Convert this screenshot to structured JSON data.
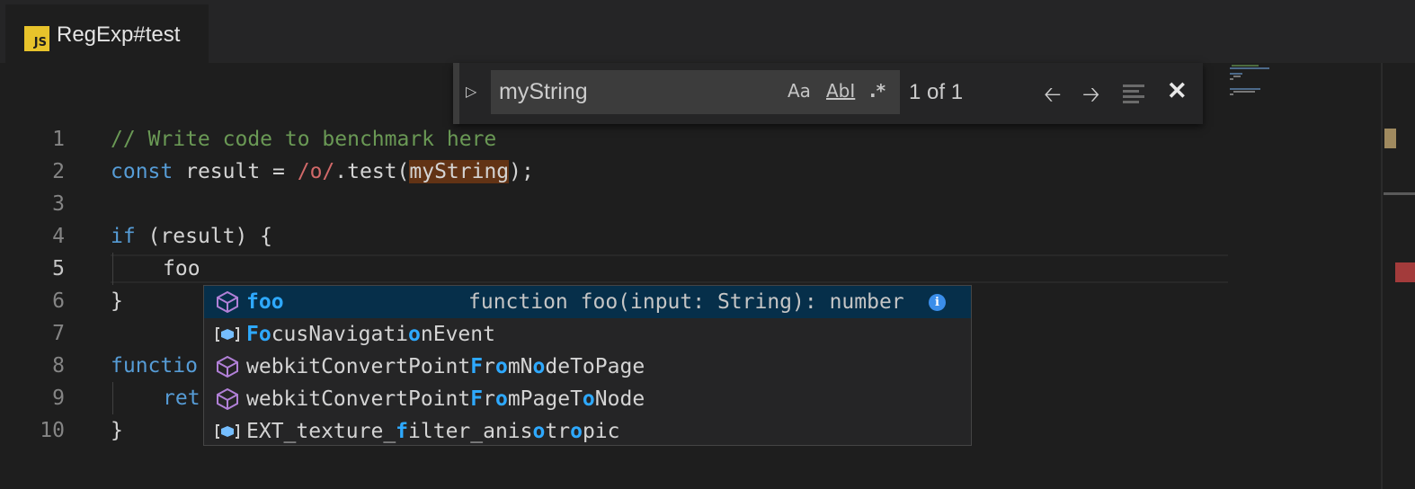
{
  "tab": {
    "icon": "JS",
    "title": "RegExp#test"
  },
  "find": {
    "query": "myString",
    "options": {
      "match_case": "Aa",
      "whole_word": "AbI",
      "regex": ".*"
    },
    "match_count": "1 of 1",
    "prev_icon": "arrow-left-icon",
    "next_icon": "arrow-right-icon",
    "selection_icon": "find-in-selection-icon",
    "close": "✕"
  },
  "editor": {
    "line_numbers": [
      "1",
      "2",
      "3",
      "4",
      "5",
      "6",
      "7",
      "8",
      "9",
      "10"
    ],
    "active_line": "5",
    "lines": {
      "l1": "// Write code to benchmark here",
      "l2_kw": "const",
      "l2_a": " result = ",
      "l2_rx": "/o/",
      "l2_b": ".test(",
      "l2_hl": "myString",
      "l2_c": ");",
      "l4_kw": "if",
      "l4_rest": " (result) {",
      "l5": "foo",
      "l6": "}",
      "l8": "functio",
      "l9": "ret",
      "l10": "}"
    }
  },
  "suggest": {
    "items": [
      {
        "kind": "method",
        "parts": [
          [
            "foo",
            true
          ]
        ],
        "detail": "function foo(input: String): number"
      },
      {
        "kind": "field",
        "parts": [
          [
            "Fo",
            true
          ],
          [
            "cusNavigati",
            false
          ],
          [
            "o",
            true
          ],
          [
            "nEvent",
            false
          ]
        ]
      },
      {
        "kind": "method",
        "parts": [
          [
            "webkitConvertPoint",
            false
          ],
          [
            "F",
            true
          ],
          [
            "r",
            false
          ],
          [
            "o",
            true
          ],
          [
            "mN",
            false
          ],
          [
            "o",
            true
          ],
          [
            "deToPage",
            false
          ]
        ]
      },
      {
        "kind": "method",
        "parts": [
          [
            "webkitConvertPoint",
            false
          ],
          [
            "F",
            true
          ],
          [
            "r",
            false
          ],
          [
            "o",
            true
          ],
          [
            "mPageT",
            false
          ],
          [
            "o",
            true
          ],
          [
            "Node",
            false
          ]
        ]
      },
      {
        "kind": "field",
        "parts": [
          [
            "EXT_texture_",
            false
          ],
          [
            "f",
            true
          ],
          [
            "ilter_anis",
            false
          ],
          [
            "o",
            true
          ],
          [
            "tr",
            false
          ],
          [
            "o",
            true
          ],
          [
            "pic",
            false
          ]
        ]
      }
    ],
    "info_icon": "i"
  },
  "colors": {
    "match_highlight": "#623315",
    "suggest_selected": "#062f4a",
    "suggest_match": "#2ea9ff"
  }
}
